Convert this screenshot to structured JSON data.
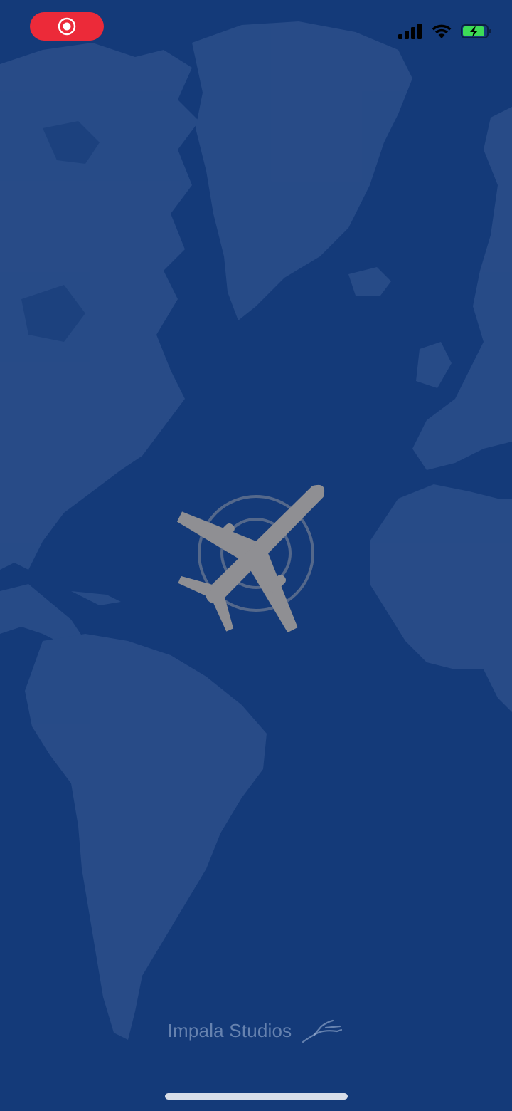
{
  "app": {
    "screen": "splash"
  },
  "status_bar": {
    "recording_indicator": "record-icon",
    "icons": [
      "cellular-signal-icon",
      "wifi-icon",
      "battery-charging-icon"
    ]
  },
  "background": {
    "image": "world-map",
    "color": "#143a79"
  },
  "splash": {
    "logo_icon": "airplane-icon"
  },
  "footer": {
    "brand_name": "Impala Studios",
    "brand_logo": "impala-logo-icon"
  },
  "colors": {
    "background": "#143a79",
    "landmass": "#2b4f8a",
    "record_pill": "#ec2a39",
    "plane": "#8f8f93",
    "battery_charge": "#3ddc57"
  }
}
